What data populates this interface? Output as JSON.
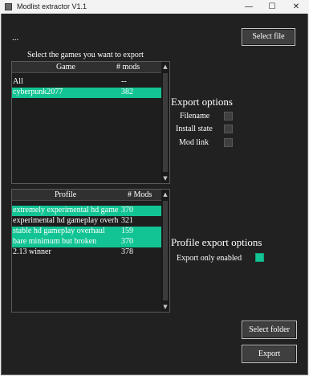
{
  "window": {
    "title": "Modlist extractor V1.1",
    "controls": {
      "minimize": "—",
      "maximize": "☐",
      "close": "✕"
    }
  },
  "path_text": "...",
  "select_file_label": "Select file",
  "select_games_label": "Select the games you want to export",
  "games": {
    "headers": [
      "Game",
      "# mods"
    ],
    "rows": [
      {
        "name": "All",
        "count": "--",
        "selected": false
      },
      {
        "name": "cyberpunk2077",
        "count": "382",
        "selected": true
      }
    ]
  },
  "profiles": {
    "headers": [
      "Profile",
      "# Mods"
    ],
    "rows": [
      {
        "name": "extremely experimental hd game",
        "count": "370",
        "selected": true
      },
      {
        "name": "experimental hd gameplay overh",
        "count": "321",
        "selected": false
      },
      {
        "name": "stable hd gameplay overhaul",
        "count": "159",
        "selected": true
      },
      {
        "name": "bare minimum but broken",
        "count": "370",
        "selected": true
      },
      {
        "name": "2.13 winner",
        "count": "378",
        "selected": false
      }
    ]
  },
  "export_options": {
    "title": "Export options",
    "items": [
      {
        "label": "Filename",
        "checked": false
      },
      {
        "label": "Install state",
        "checked": false
      },
      {
        "label": "Mod link",
        "checked": false
      }
    ]
  },
  "profile_export_options": {
    "title": "Profile export options",
    "items": [
      {
        "label": "Export only enabled",
        "checked": true
      }
    ]
  },
  "select_folder_label": "Select folder",
  "export_label": "Export",
  "colors": {
    "accent": "#12c493",
    "background": "#212121",
    "button": "#3f3f3f"
  }
}
